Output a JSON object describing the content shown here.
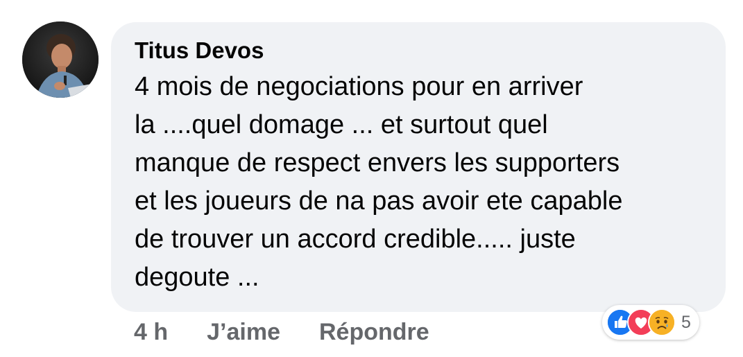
{
  "comment": {
    "author": "Titus Devos",
    "text": "4 mois de negociations pour en arriver\nla ....quel domage ... et surtout quel\nmanque de respect envers les supporters\net les joueurs de na pas avoir ete capable\nde trouver un accord credible..... juste\ndegoute ...",
    "timestamp": "4 h",
    "like_label": "J’aime",
    "reply_label": "Répondre"
  },
  "reactions": {
    "icons": [
      "like-icon",
      "love-icon",
      "sad-icon"
    ],
    "count": "5",
    "colors": {
      "like": "#1877f2",
      "love": "#f33e58",
      "sad": "#f7b125"
    }
  }
}
